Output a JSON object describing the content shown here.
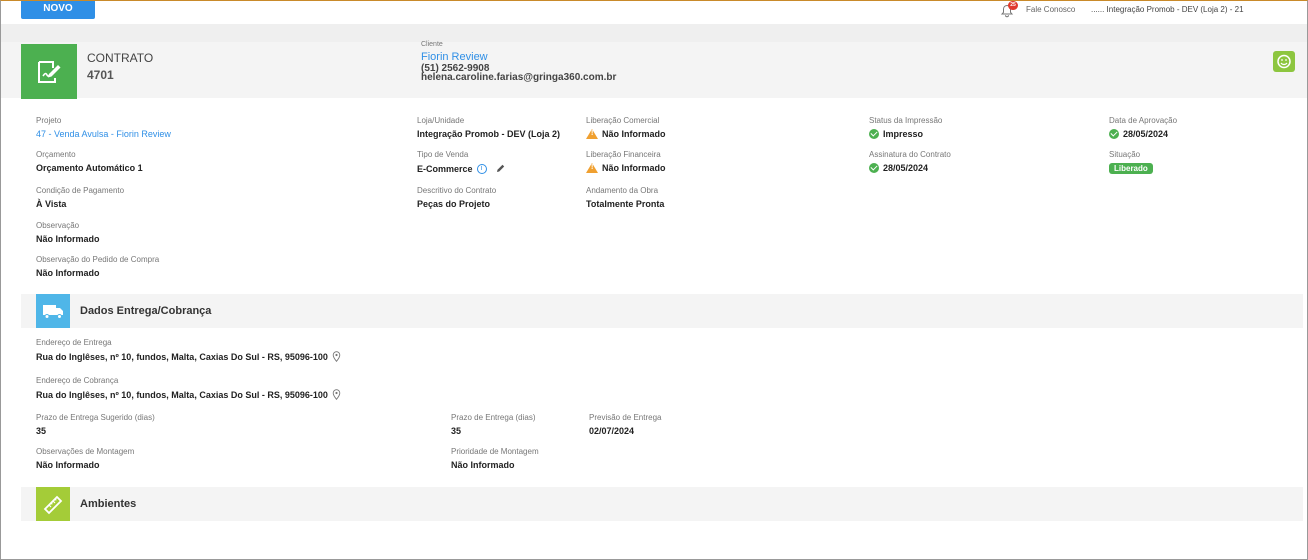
{
  "topbar": {
    "new_button": "NOVO",
    "notification_count": "25",
    "contact_link": "Fale Conosco",
    "store_selector": "...... Integração Promob - DEV (Loja 2) - 21"
  },
  "header": {
    "title": "CONTRATO",
    "number": "4701",
    "client_label": "Cliente",
    "client_name": "Fiorin Review",
    "client_phone": "(51) 2562-9908",
    "client_email": "helena.caroline.farias@gringa360.com.br"
  },
  "details": {
    "projeto": {
      "label": "Projeto",
      "value": "47 - Venda Avulsa - Fiorin Review"
    },
    "orcamento": {
      "label": "Orçamento",
      "value": "Orçamento Automático 1"
    },
    "condicao": {
      "label": "Condição de Pagamento",
      "value": "À Vista"
    },
    "observacao": {
      "label": "Observação",
      "value": "Não Informado"
    },
    "obs_pedido": {
      "label": "Observação do Pedido de Compra",
      "value": "Não Informado"
    },
    "loja": {
      "label": "Loja/Unidade",
      "value": "Integração Promob - DEV (Loja 2)"
    },
    "tipo_venda": {
      "label": "Tipo de Venda",
      "value": "E-Commerce"
    },
    "descritivo": {
      "label": "Descritivo do Contrato",
      "value": "Peças do Projeto"
    },
    "lib_comercial": {
      "label": "Liberação Comercial",
      "value": "Não Informado"
    },
    "lib_financeira": {
      "label": "Liberação Financeira",
      "value": "Não Informado"
    },
    "andamento": {
      "label": "Andamento da Obra",
      "value": "Totalmente Pronta"
    },
    "status_impressao": {
      "label": "Status da Impressão",
      "value": "Impresso"
    },
    "assinatura": {
      "label": "Assinatura do Contrato",
      "value": "28/05/2024"
    },
    "data_aprovacao": {
      "label": "Data de Aprovação",
      "value": "28/05/2024"
    },
    "situacao": {
      "label": "Situação",
      "value": "Liberado"
    }
  },
  "delivery": {
    "title": "Dados Entrega/Cobrança",
    "endereco_entrega": {
      "label": "Endereço de Entrega",
      "value": "Rua do Inglêses, nº 10, fundos, Malta, Caxias Do Sul - RS, 95096-100"
    },
    "endereco_cobranca": {
      "label": "Endereço de Cobrança",
      "value": "Rua do Inglêses, nº 10, fundos, Malta, Caxias Do Sul - RS, 95096-100"
    },
    "prazo_sugerido": {
      "label": "Prazo de Entrega Sugerido (dias)",
      "value": "35"
    },
    "prazo": {
      "label": "Prazo de Entrega (dias)",
      "value": "35"
    },
    "previsao": {
      "label": "Previsão de Entrega",
      "value": "02/07/2024"
    },
    "obs_montagem": {
      "label": "Observações de Montagem",
      "value": "Não Informado"
    },
    "prioridade": {
      "label": "Prioridade de Montagem",
      "value": "Não Informado"
    }
  },
  "ambientes": {
    "title": "Ambientes"
  },
  "colors": {
    "primary": "#2f8fe6",
    "green": "#4cb050",
    "lime": "#8dc63f",
    "truck_blue": "#4fb6e8",
    "warning": "#f0a030"
  }
}
